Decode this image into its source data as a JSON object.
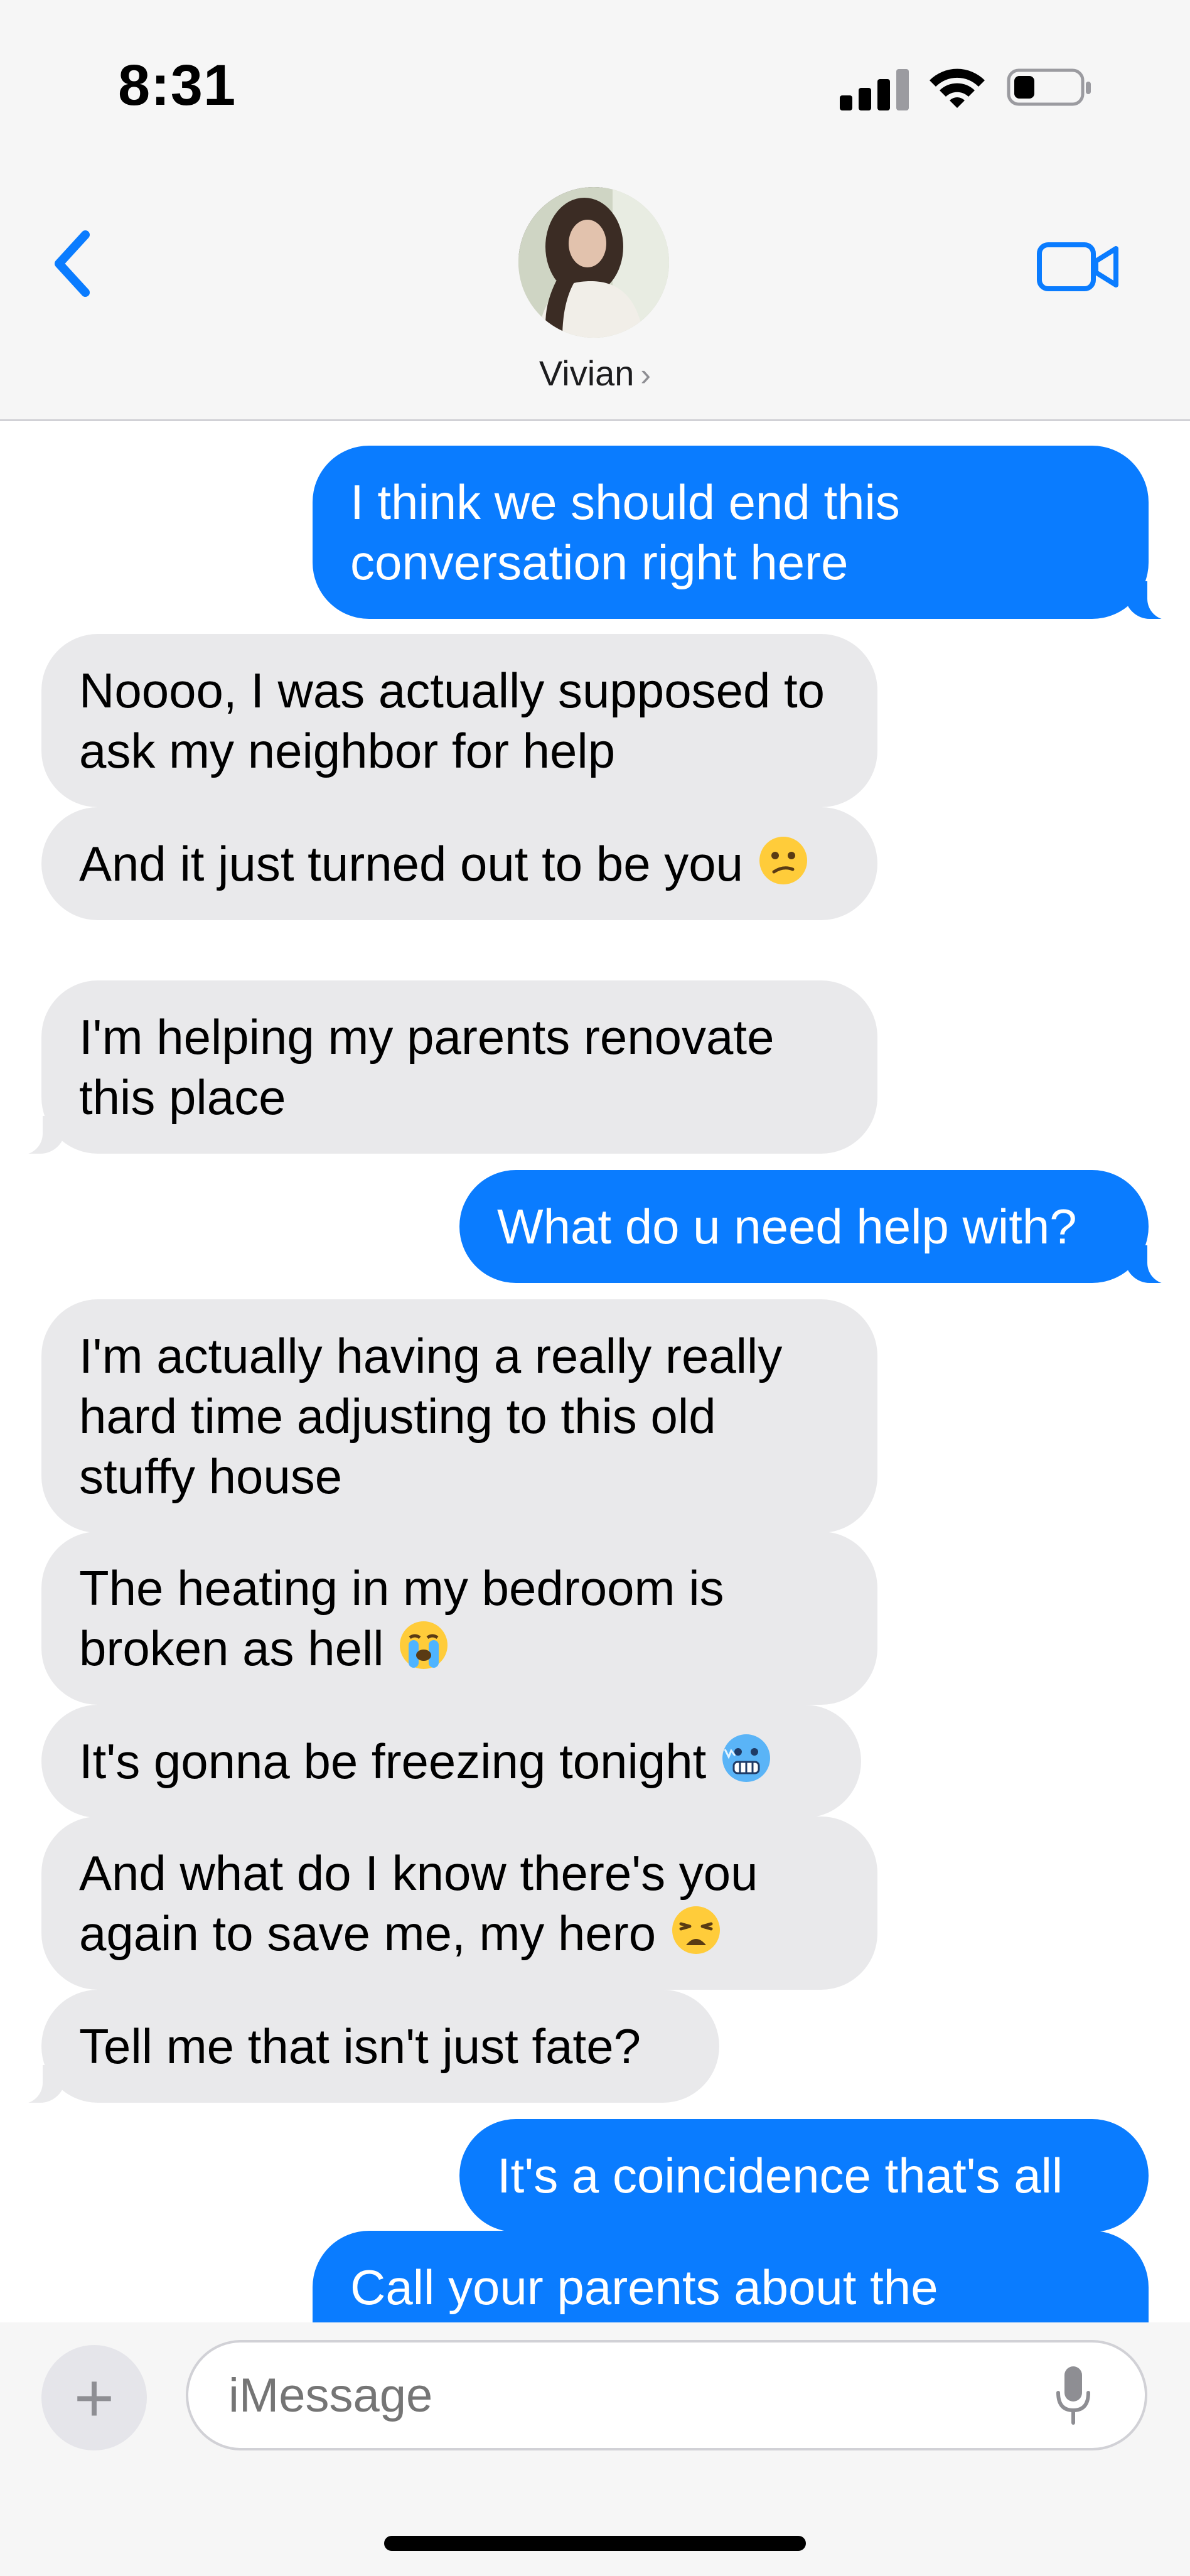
{
  "status_bar": {
    "time": "8:31"
  },
  "header": {
    "contact_name": "Vivian",
    "chevron": "›"
  },
  "messages": [
    {
      "side": "out",
      "text": "I think we should end this conversation right here"
    },
    {
      "side": "in",
      "text": "Noooo, I was actually supposed to ask my neighbor for help"
    },
    {
      "side": "in",
      "text": "And it just turned out to be you",
      "emoji": "confused-face"
    },
    {
      "side": "in",
      "text": "I'm helping my parents renovate this place"
    },
    {
      "side": "out",
      "text": "What do u need help with?"
    },
    {
      "side": "in",
      "text": "I'm actually having a really really hard time adjusting to this old stuffy house"
    },
    {
      "side": "in",
      "text": "The heating in my bedroom is broken as hell",
      "emoji": "loudly-crying-face"
    },
    {
      "side": "in",
      "text": "It's gonna be freezing tonight",
      "emoji": "cold-face"
    },
    {
      "side": "in",
      "text": "And what do I know there's you again to save me, my hero",
      "emoji": "weary-face"
    },
    {
      "side": "in",
      "text": "Tell me that isn't just fate?"
    },
    {
      "side": "out",
      "text": "It's a coincidence that's all"
    },
    {
      "side": "out",
      "text": "Call your parents about the"
    }
  ],
  "composer": {
    "plus": "+",
    "placeholder": "iMessage"
  },
  "colors": {
    "outgoing": "#0a7cff",
    "incoming": "#e9e9eb",
    "accent": "#0a7cff"
  }
}
